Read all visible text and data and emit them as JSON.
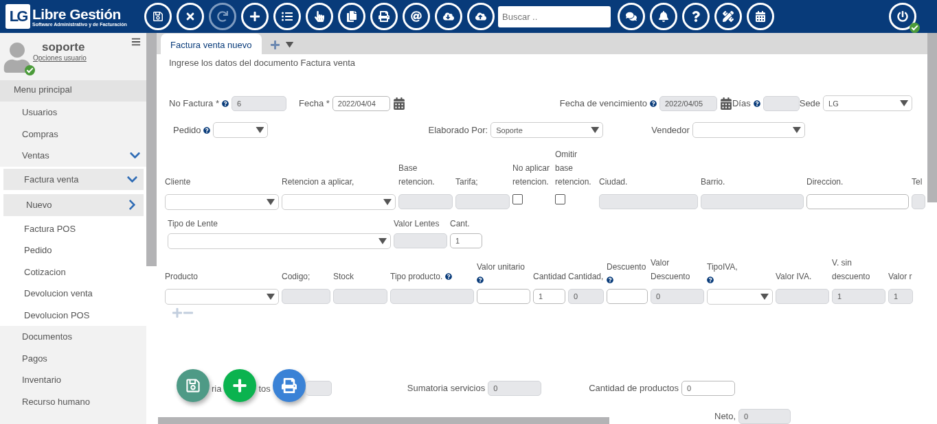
{
  "header": {
    "logo": {
      "mark": "LG",
      "title": "Libre Gestión",
      "subtitle": "Software Administrativo y de Facturación"
    },
    "tools": [
      {
        "kind": "save",
        "disabled": false
      },
      {
        "kind": "cancel",
        "disabled": false
      },
      {
        "kind": "redo",
        "disabled": true
      },
      {
        "kind": "add",
        "disabled": false
      },
      {
        "kind": "list",
        "disabled": false
      },
      {
        "kind": "pointer",
        "disabled": false
      },
      {
        "kind": "copy",
        "disabled": false
      },
      {
        "kind": "print",
        "disabled": false
      },
      {
        "kind": "email",
        "disabled": false
      },
      {
        "kind": "download",
        "disabled": false
      },
      {
        "kind": "upload",
        "disabled": false
      }
    ],
    "search": {
      "placeholder": "Buscar .."
    },
    "tools_right": [
      {
        "kind": "chat",
        "disabled": false
      },
      {
        "kind": "bell",
        "disabled": false
      },
      {
        "kind": "help",
        "disabled": false
      },
      {
        "kind": "tools",
        "disabled": false
      },
      {
        "kind": "calendar",
        "disabled": false
      }
    ],
    "session": {
      "online": true
    }
  },
  "sidebar": {
    "user": {
      "name": "soporte",
      "link": "Opciones usuario",
      "online": true
    },
    "menu_title": "Menu principal",
    "items": [
      {
        "label": "Usuarios",
        "selected": false
      },
      {
        "label": "Compras",
        "selected": false
      },
      {
        "label": "Ventas",
        "expanded": true,
        "selected": false,
        "children": [
          {
            "label": "Factura venta",
            "expanded": true,
            "children": [
              {
                "label": "Nuevo",
                "selected": true
              }
            ]
          },
          {
            "label": "Factura POS",
            "selected": false
          },
          {
            "label": "Pedido",
            "selected": false
          },
          {
            "label": "Cotizacion",
            "selected": false
          },
          {
            "label": "Devolucion venta",
            "selected": false
          },
          {
            "label": "Devolucion POS",
            "selected": false
          }
        ]
      },
      {
        "label": "Documentos",
        "selected": false
      },
      {
        "label": "Pagos",
        "selected": false
      },
      {
        "label": "Inventario",
        "selected": false
      },
      {
        "label": "Recurso humano",
        "selected": false
      }
    ]
  },
  "tabs": [
    {
      "label": "Factura venta nuevo",
      "selected": true
    }
  ],
  "instructions": "Ingrese los datos del documento Factura venta",
  "rows": [
    {
      "fields": [
        {
          "label": "No Factura *",
          "help": true,
          "kind": "text",
          "readonly": true,
          "value": "6"
        },
        {
          "label": "Fecha *",
          "kind": "date",
          "readonly": false,
          "value": "2022/04/04"
        },
        {
          "label": "Fecha de vencimiento",
          "help": true,
          "kind": "date",
          "readonly": true,
          "value": "2022/04/05"
        },
        {
          "label": "Días",
          "help": true,
          "kind": "text",
          "readonly": true
        },
        {
          "label": "Sede",
          "kind": "select",
          "value": "LG"
        }
      ]
    },
    {
      "fields": [
        {
          "label": "Pedido",
          "help": true,
          "kind": "select"
        },
        {
          "label": "Elaborado Por:",
          "kind": "select",
          "value": "Soporte"
        },
        {
          "label": "Vendedor",
          "kind": "select"
        }
      ]
    }
  ],
  "grids": [
    {
      "columns": [
        {
          "label": "Cliente",
          "kind": "select"
        },
        {
          "label": "Retencion a aplicar,",
          "kind": "select"
        },
        {
          "label": "Base retencion.",
          "kind": "text",
          "readonly": true
        },
        {
          "label": "Tarifa;",
          "kind": "text",
          "readonly": true
        },
        {
          "label": "No aplicar retencion.",
          "kind": "checkbox",
          "checked": false
        },
        {
          "label": "Omitir base retencion.",
          "kind": "checkbox",
          "checked": false
        },
        {
          "label": "Ciudad.",
          "kind": "text",
          "readonly": true
        },
        {
          "label": "Barrio.",
          "kind": "text",
          "readonly": true
        },
        {
          "label": "Direccion.",
          "kind": "text",
          "readonly": false
        },
        {
          "label": "Tel",
          "kind": "text",
          "readonly": true
        }
      ]
    },
    {
      "columns": [
        {
          "label": "Tipo de Lente",
          "kind": "select"
        },
        {
          "label": "Valor Lentes",
          "kind": "text",
          "readonly": true
        },
        {
          "label": "Cant.",
          "kind": "text",
          "readonly": false,
          "value": "1"
        }
      ]
    },
    {
      "columns": [
        {
          "label": "Producto",
          "kind": "select"
        },
        {
          "label": "Codigo;",
          "kind": "text",
          "readonly": true
        },
        {
          "label": "Stock",
          "kind": "text",
          "readonly": true
        },
        {
          "label": "Tipo producto.",
          "help": true,
          "kind": "text",
          "readonly": true
        },
        {
          "label": "Valor unitario",
          "help": true,
          "kind": "text",
          "readonly": false
        },
        {
          "label": "Cantidad",
          "kind": "text",
          "readonly": false,
          "value": "1"
        },
        {
          "label": "Cantidad,",
          "kind": "text",
          "readonly": true,
          "value": "0"
        },
        {
          "label": "Descuento",
          "help": true,
          "kind": "text",
          "readonly": false
        },
        {
          "label": "Valor Descuento",
          "kind": "text",
          "readonly": true,
          "value": "0"
        },
        {
          "label": "TipoIVA,",
          "help": true,
          "kind": "select"
        },
        {
          "label": "Valor IVA.",
          "kind": "text",
          "readonly": true
        },
        {
          "label": "V. sin descuento",
          "kind": "text",
          "readonly": true,
          "value": "1"
        },
        {
          "label": "Valor r",
          "kind": "text",
          "readonly": true,
          "value": "1"
        }
      ]
    }
  ],
  "floating_buttons": [
    {
      "kind": "save"
    },
    {
      "kind": "add"
    },
    {
      "kind": "print"
    }
  ],
  "summary": {
    "partial_label": [
      "ria",
      "tos"
    ],
    "partial_field": {
      "readonly": true
    },
    "fields": [
      {
        "label": "Sumatoria servicios",
        "readonly": true,
        "value": "0"
      },
      {
        "label": "Cantidad de productos",
        "readonly": false,
        "value": "0"
      }
    ],
    "total": {
      "label": "Neto,",
      "readonly": true,
      "value": "0"
    }
  }
}
